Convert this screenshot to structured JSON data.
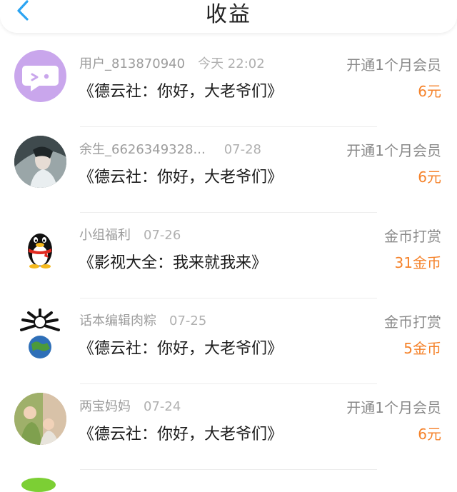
{
  "header": {
    "title": "收益",
    "back_icon": "chevron-left-icon",
    "accent": "#2ba4f2"
  },
  "items": [
    {
      "user": "用户_813870940",
      "date": "今天 22:02",
      "book": "《德云社：你好，大老爷们》",
      "type": "开通1个月会员",
      "amount": "6元",
      "avatar_icon": "chat-bubble-icon"
    },
    {
      "user": "余生_6626349328...",
      "date": "07-28",
      "book": "《德云社：你好，大老爷们》",
      "type": "开通1个月会员",
      "amount": "6元",
      "avatar_icon": "portrait-avatar"
    },
    {
      "user": "小组福利",
      "date": "07-26",
      "book": "《影视大全：我来就我来》",
      "type": "金币打赏",
      "amount": "31金币",
      "avatar_icon": "penguin-icon"
    },
    {
      "user": "话本编辑肉粽",
      "date": "07-25",
      "book": "《德云社：你好，大老爷们》",
      "type": "金币打赏",
      "amount": "5金币",
      "avatar_icon": "globe-avatar"
    },
    {
      "user": "两宝妈妈",
      "date": "07-24",
      "book": "《德云社：你好，大老爷们》",
      "type": "开通1个月会员",
      "amount": "6元",
      "avatar_icon": "photo-avatar"
    }
  ],
  "colors": {
    "amount": "#f5822a",
    "meta": "#9c9c9c"
  }
}
